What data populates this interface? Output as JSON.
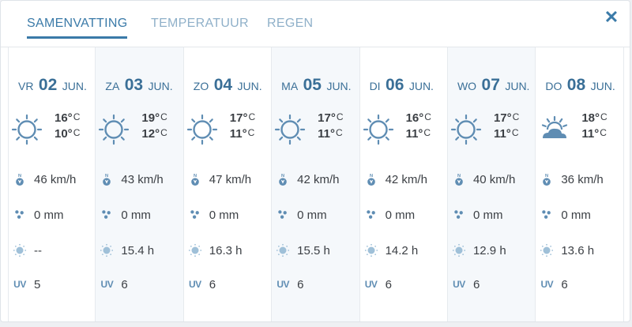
{
  "tabs": [
    {
      "label": "SAMENVATTING",
      "active": true
    },
    {
      "label": "TEMPERATUUR",
      "active": false
    },
    {
      "label": "REGEN",
      "active": false
    }
  ],
  "close_icon": "close-icon",
  "colors": {
    "accent": "#3a7aa8",
    "icon": "#5f8db3",
    "shaded": "#f5f8fb"
  },
  "wind_arrow_label": "N",
  "days": [
    {
      "dow": "VR",
      "num": "02",
      "mon": "JUN.",
      "icon": "sun-icon",
      "max": "16°",
      "min": "10°",
      "unit": "C",
      "wind": "46 km/h",
      "rain": "0 mm",
      "sun": "--",
      "uv_label": "UV",
      "uv": "5"
    },
    {
      "dow": "ZA",
      "num": "03",
      "mon": "JUN.",
      "icon": "sun-icon",
      "max": "19°",
      "min": "12°",
      "unit": "C",
      "wind": "43 km/h",
      "rain": "0 mm",
      "sun": "15.4 h",
      "uv_label": "UV",
      "uv": "6"
    },
    {
      "dow": "ZO",
      "num": "04",
      "mon": "JUN.",
      "icon": "sun-icon",
      "max": "17°",
      "min": "11°",
      "unit": "C",
      "wind": "47 km/h",
      "rain": "0 mm",
      "sun": "16.3 h",
      "uv_label": "UV",
      "uv": "6"
    },
    {
      "dow": "MA",
      "num": "05",
      "mon": "JUN.",
      "icon": "sun-icon",
      "max": "17°",
      "min": "11°",
      "unit": "C",
      "wind": "42 km/h",
      "rain": "0 mm",
      "sun": "15.5 h",
      "uv_label": "UV",
      "uv": "6"
    },
    {
      "dow": "DI",
      "num": "06",
      "mon": "JUN.",
      "icon": "sun-icon",
      "max": "16°",
      "min": "11°",
      "unit": "C",
      "wind": "42 km/h",
      "rain": "0 mm",
      "sun": "14.2 h",
      "uv_label": "UV",
      "uv": "6"
    },
    {
      "dow": "WO",
      "num": "07",
      "mon": "JUN.",
      "icon": "sun-icon",
      "max": "17°",
      "min": "11°",
      "unit": "C",
      "wind": "40 km/h",
      "rain": "0 mm",
      "sun": "12.9 h",
      "uv_label": "UV",
      "uv": "6"
    },
    {
      "dow": "DO",
      "num": "08",
      "mon": "JUN.",
      "icon": "partly-cloudy-icon",
      "max": "18°",
      "min": "11°",
      "unit": "C",
      "wind": "36 km/h",
      "rain": "0 mm",
      "sun": "13.6 h",
      "uv_label": "UV",
      "uv": "6"
    }
  ]
}
